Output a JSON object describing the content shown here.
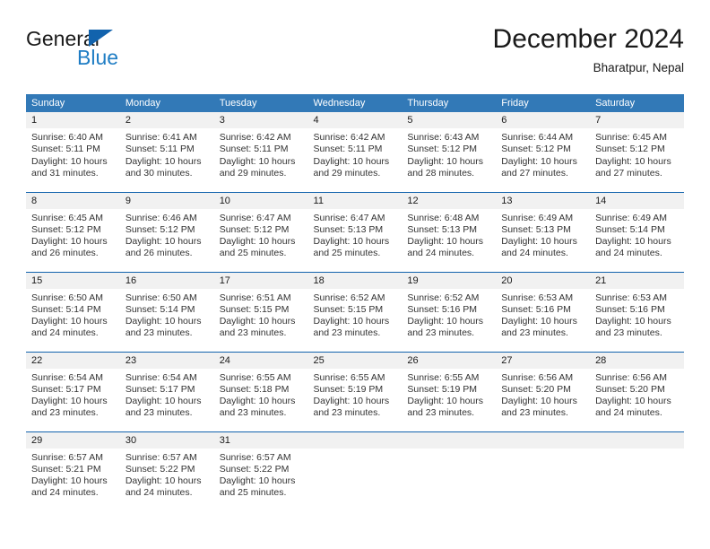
{
  "brand": {
    "name_top": "General",
    "name_bottom": "Blue",
    "triangle_color": "#1263ad",
    "blue_text_color": "#1f7dc4"
  },
  "header": {
    "title": "December 2024",
    "location": "Bharatpur, Nepal"
  },
  "colors": {
    "header_row_bg": "#3279b7",
    "header_row_text": "#ffffff",
    "row_divider": "#1263ad",
    "daynum_band_bg": "#f1f1f1",
    "cell_bg": "#ffffff",
    "body_text": "#333333"
  },
  "weekday_headers": [
    "Sunday",
    "Monday",
    "Tuesday",
    "Wednesday",
    "Thursday",
    "Friday",
    "Saturday"
  ],
  "weeks": [
    [
      {
        "day": "1",
        "sunrise": "Sunrise: 6:40 AM",
        "sunset": "Sunset: 5:11 PM",
        "daylight_1": "Daylight: 10 hours",
        "daylight_2": "and 31 minutes."
      },
      {
        "day": "2",
        "sunrise": "Sunrise: 6:41 AM",
        "sunset": "Sunset: 5:11 PM",
        "daylight_1": "Daylight: 10 hours",
        "daylight_2": "and 30 minutes."
      },
      {
        "day": "3",
        "sunrise": "Sunrise: 6:42 AM",
        "sunset": "Sunset: 5:11 PM",
        "daylight_1": "Daylight: 10 hours",
        "daylight_2": "and 29 minutes."
      },
      {
        "day": "4",
        "sunrise": "Sunrise: 6:42 AM",
        "sunset": "Sunset: 5:11 PM",
        "daylight_1": "Daylight: 10 hours",
        "daylight_2": "and 29 minutes."
      },
      {
        "day": "5",
        "sunrise": "Sunrise: 6:43 AM",
        "sunset": "Sunset: 5:12 PM",
        "daylight_1": "Daylight: 10 hours",
        "daylight_2": "and 28 minutes."
      },
      {
        "day": "6",
        "sunrise": "Sunrise: 6:44 AM",
        "sunset": "Sunset: 5:12 PM",
        "daylight_1": "Daylight: 10 hours",
        "daylight_2": "and 27 minutes."
      },
      {
        "day": "7",
        "sunrise": "Sunrise: 6:45 AM",
        "sunset": "Sunset: 5:12 PM",
        "daylight_1": "Daylight: 10 hours",
        "daylight_2": "and 27 minutes."
      }
    ],
    [
      {
        "day": "8",
        "sunrise": "Sunrise: 6:45 AM",
        "sunset": "Sunset: 5:12 PM",
        "daylight_1": "Daylight: 10 hours",
        "daylight_2": "and 26 minutes."
      },
      {
        "day": "9",
        "sunrise": "Sunrise: 6:46 AM",
        "sunset": "Sunset: 5:12 PM",
        "daylight_1": "Daylight: 10 hours",
        "daylight_2": "and 26 minutes."
      },
      {
        "day": "10",
        "sunrise": "Sunrise: 6:47 AM",
        "sunset": "Sunset: 5:12 PM",
        "daylight_1": "Daylight: 10 hours",
        "daylight_2": "and 25 minutes."
      },
      {
        "day": "11",
        "sunrise": "Sunrise: 6:47 AM",
        "sunset": "Sunset: 5:13 PM",
        "daylight_1": "Daylight: 10 hours",
        "daylight_2": "and 25 minutes."
      },
      {
        "day": "12",
        "sunrise": "Sunrise: 6:48 AM",
        "sunset": "Sunset: 5:13 PM",
        "daylight_1": "Daylight: 10 hours",
        "daylight_2": "and 24 minutes."
      },
      {
        "day": "13",
        "sunrise": "Sunrise: 6:49 AM",
        "sunset": "Sunset: 5:13 PM",
        "daylight_1": "Daylight: 10 hours",
        "daylight_2": "and 24 minutes."
      },
      {
        "day": "14",
        "sunrise": "Sunrise: 6:49 AM",
        "sunset": "Sunset: 5:14 PM",
        "daylight_1": "Daylight: 10 hours",
        "daylight_2": "and 24 minutes."
      }
    ],
    [
      {
        "day": "15",
        "sunrise": "Sunrise: 6:50 AM",
        "sunset": "Sunset: 5:14 PM",
        "daylight_1": "Daylight: 10 hours",
        "daylight_2": "and 24 minutes."
      },
      {
        "day": "16",
        "sunrise": "Sunrise: 6:50 AM",
        "sunset": "Sunset: 5:14 PM",
        "daylight_1": "Daylight: 10 hours",
        "daylight_2": "and 23 minutes."
      },
      {
        "day": "17",
        "sunrise": "Sunrise: 6:51 AM",
        "sunset": "Sunset: 5:15 PM",
        "daylight_1": "Daylight: 10 hours",
        "daylight_2": "and 23 minutes."
      },
      {
        "day": "18",
        "sunrise": "Sunrise: 6:52 AM",
        "sunset": "Sunset: 5:15 PM",
        "daylight_1": "Daylight: 10 hours",
        "daylight_2": "and 23 minutes."
      },
      {
        "day": "19",
        "sunrise": "Sunrise: 6:52 AM",
        "sunset": "Sunset: 5:16 PM",
        "daylight_1": "Daylight: 10 hours",
        "daylight_2": "and 23 minutes."
      },
      {
        "day": "20",
        "sunrise": "Sunrise: 6:53 AM",
        "sunset": "Sunset: 5:16 PM",
        "daylight_1": "Daylight: 10 hours",
        "daylight_2": "and 23 minutes."
      },
      {
        "day": "21",
        "sunrise": "Sunrise: 6:53 AM",
        "sunset": "Sunset: 5:16 PM",
        "daylight_1": "Daylight: 10 hours",
        "daylight_2": "and 23 minutes."
      }
    ],
    [
      {
        "day": "22",
        "sunrise": "Sunrise: 6:54 AM",
        "sunset": "Sunset: 5:17 PM",
        "daylight_1": "Daylight: 10 hours",
        "daylight_2": "and 23 minutes."
      },
      {
        "day": "23",
        "sunrise": "Sunrise: 6:54 AM",
        "sunset": "Sunset: 5:17 PM",
        "daylight_1": "Daylight: 10 hours",
        "daylight_2": "and 23 minutes."
      },
      {
        "day": "24",
        "sunrise": "Sunrise: 6:55 AM",
        "sunset": "Sunset: 5:18 PM",
        "daylight_1": "Daylight: 10 hours",
        "daylight_2": "and 23 minutes."
      },
      {
        "day": "25",
        "sunrise": "Sunrise: 6:55 AM",
        "sunset": "Sunset: 5:19 PM",
        "daylight_1": "Daylight: 10 hours",
        "daylight_2": "and 23 minutes."
      },
      {
        "day": "26",
        "sunrise": "Sunrise: 6:55 AM",
        "sunset": "Sunset: 5:19 PM",
        "daylight_1": "Daylight: 10 hours",
        "daylight_2": "and 23 minutes."
      },
      {
        "day": "27",
        "sunrise": "Sunrise: 6:56 AM",
        "sunset": "Sunset: 5:20 PM",
        "daylight_1": "Daylight: 10 hours",
        "daylight_2": "and 23 minutes."
      },
      {
        "day": "28",
        "sunrise": "Sunrise: 6:56 AM",
        "sunset": "Sunset: 5:20 PM",
        "daylight_1": "Daylight: 10 hours",
        "daylight_2": "and 24 minutes."
      }
    ],
    [
      {
        "day": "29",
        "sunrise": "Sunrise: 6:57 AM",
        "sunset": "Sunset: 5:21 PM",
        "daylight_1": "Daylight: 10 hours",
        "daylight_2": "and 24 minutes."
      },
      {
        "day": "30",
        "sunrise": "Sunrise: 6:57 AM",
        "sunset": "Sunset: 5:22 PM",
        "daylight_1": "Daylight: 10 hours",
        "daylight_2": "and 24 minutes."
      },
      {
        "day": "31",
        "sunrise": "Sunrise: 6:57 AM",
        "sunset": "Sunset: 5:22 PM",
        "daylight_1": "Daylight: 10 hours",
        "daylight_2": "and 25 minutes."
      },
      {
        "day": "",
        "sunrise": "",
        "sunset": "",
        "daylight_1": "",
        "daylight_2": ""
      },
      {
        "day": "",
        "sunrise": "",
        "sunset": "",
        "daylight_1": "",
        "daylight_2": ""
      },
      {
        "day": "",
        "sunrise": "",
        "sunset": "",
        "daylight_1": "",
        "daylight_2": ""
      },
      {
        "day": "",
        "sunrise": "",
        "sunset": "",
        "daylight_1": "",
        "daylight_2": ""
      }
    ]
  ]
}
